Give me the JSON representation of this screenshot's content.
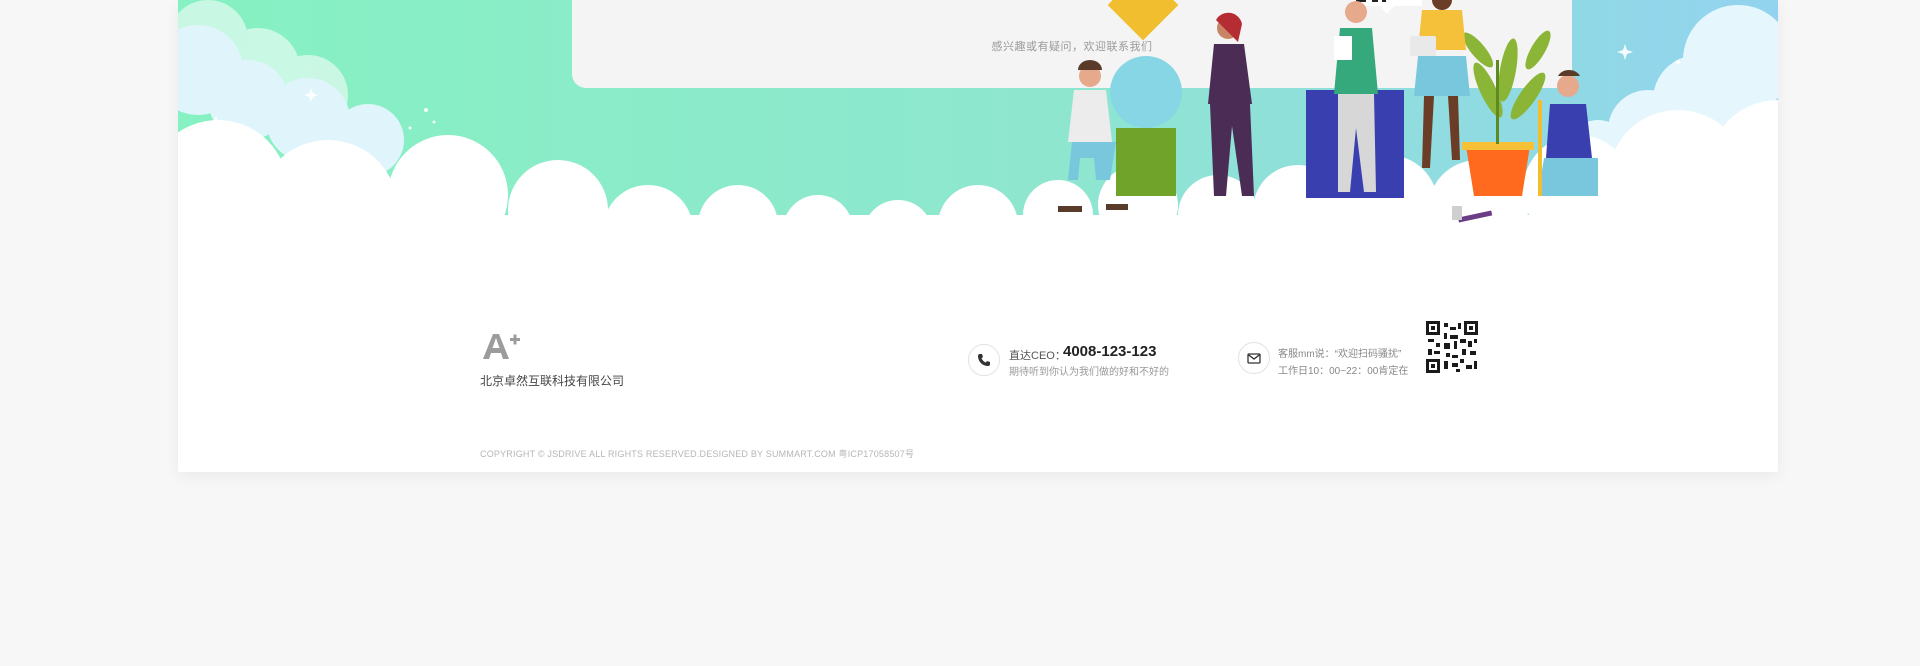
{
  "banner": {
    "card_note": "感兴趣或有疑问，欢迎联系我们"
  },
  "footer": {
    "logo_text": "A+",
    "company_name": "北京卓然互联科技有限公司",
    "ceo_label": "直达CEO：",
    "ceo_phone": "4008-123-123",
    "ceo_sub": "期待听到你认为我们做的好和不好的",
    "service_line1": "客服mm说：“欢迎扫码骚扰”",
    "service_line2": "工作日10：00~22：00肯定在",
    "copyright": "COPYRIGHT © JSDRIVE ALL RIGHTS RESERVED.DESIGNED BY SUMMART.COM   粤ICP17058507号"
  },
  "icons": {
    "phone": "phone-icon",
    "mail": "mail-icon",
    "qr": "qr-code-icon",
    "logo": "a-plus-logo"
  },
  "colors": {
    "banner_green": "#86f0c0",
    "banner_blue": "#8fd6ea",
    "page_bg": "#f7f7f7"
  }
}
